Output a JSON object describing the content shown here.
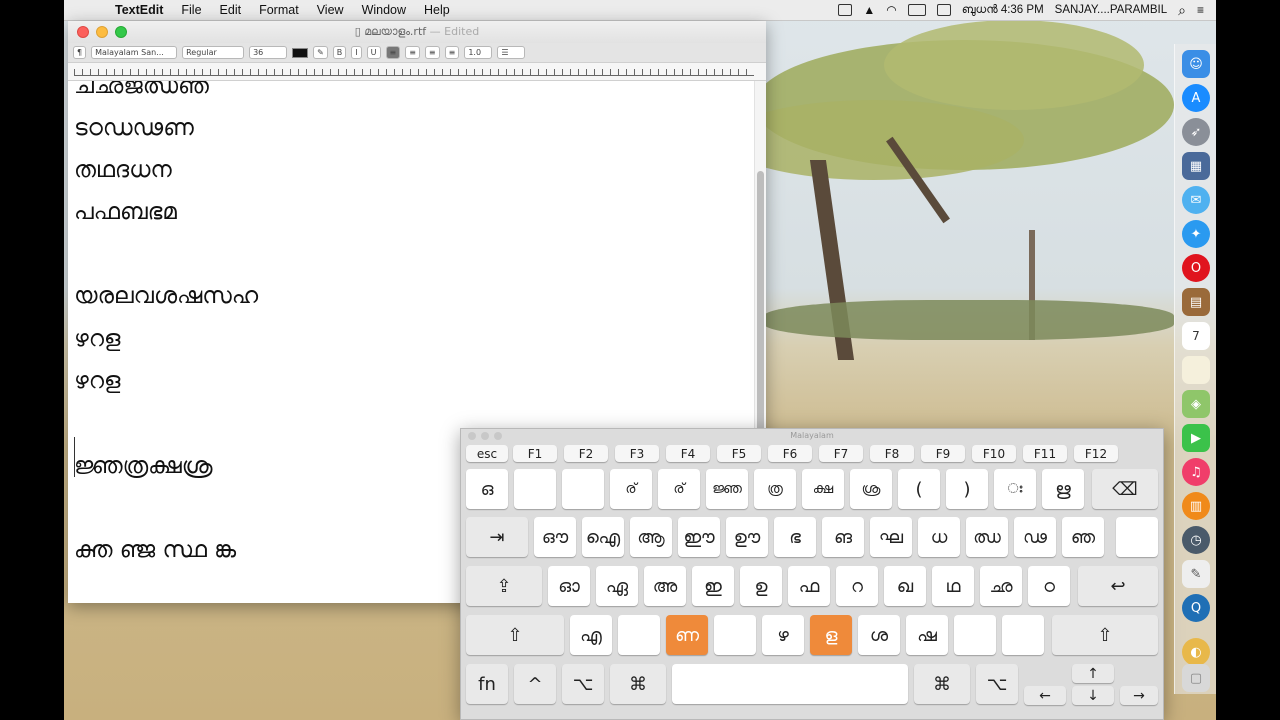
{
  "menubar": {
    "apple_icon": "",
    "app_name": "TextEdit",
    "items": [
      "File",
      "Edit",
      "Format",
      "View",
      "Window",
      "Help"
    ],
    "clock": "ബുധൻ 4:36 PM",
    "user": "SANJAY....PARAMBIL",
    "search_glyph": "⌕",
    "icons": [
      "airplay-icon",
      "upload-icon",
      "wifi-icon",
      "input-source-icon",
      "display-icon",
      "search-icon"
    ]
  },
  "textedit": {
    "filename": "മലയാളം.rtf",
    "edited": "— Edited",
    "toolbar": {
      "paragraph": "¶",
      "font": "Malayalam San...",
      "style": "Regular",
      "size": "36",
      "bold": "B",
      "italic": "I",
      "underline": "U",
      "spacing": "1.0"
    },
    "lines": [
      "ചഛജഝഞ",
      "ടഠഡഢണ",
      "തഥദധന",
      "പഫബഭമ",
      "",
      "യരലവശഷസഹ",
      "ഴറള",
      "ഴറള",
      "",
      "ജ്ഞത്രക്ഷശ്ര",
      "",
      "ക്ത ഞ്ജ സ്ഥ ങ്ക"
    ]
  },
  "keyboard": {
    "title": "Malayalam",
    "fn_row": [
      "esc",
      "F1",
      "F2",
      "F3",
      "F4",
      "F5",
      "F6",
      "F7",
      "F8",
      "F9",
      "F10",
      "F11",
      "F12"
    ],
    "row1": [
      "ഒ",
      "",
      "",
      "ര്",
      "ര്",
      "ജ്ഞ",
      "ത്ര",
      "ക്ഷ",
      "ശ്ര",
      "(",
      ")",
      "ഃ",
      "ഋ",
      "⌫"
    ],
    "row2": [
      "⇥",
      "ഔ",
      "ഐ",
      "ആ",
      "ഈ",
      "ഊ",
      "ഭ",
      "ങ",
      "ഘ",
      "ധ",
      "ഝ",
      "ഢ",
      "ഞ",
      ""
    ],
    "row3": [
      "⇪",
      "ഓ",
      "ഏ",
      "അ",
      "ഇ",
      "ഉ",
      "ഫ",
      "റ",
      "ഖ",
      "ഥ",
      "ഛ",
      "ഠ",
      "↩"
    ],
    "row4": [
      "⇧",
      "എ",
      "",
      "ണ",
      "",
      "ഴ",
      "ള",
      "ശ",
      "ഷ",
      "",
      "",
      "⇧"
    ],
    "row5": [
      "fn",
      "^",
      "⌥",
      "⌘",
      "",
      "⌘",
      "⌥",
      "↑",
      "←",
      "↓",
      "→"
    ],
    "highlight_color": "#ef8a3a"
  },
  "dock": {
    "icons": [
      "finder-icon",
      "app-store-icon",
      "launchpad-icon",
      "mission-control-icon",
      "messages-icon",
      "safari-icon",
      "opera-icon",
      "notes-book-icon",
      "calendar-icon",
      "notes-icon",
      "maps-icon",
      "facetime-icon",
      "itunes-icon",
      "ibooks-icon",
      "time-machine-icon",
      "textedit-icon",
      "quicktime-icon",
      "preview-icon",
      "trash-icon"
    ],
    "calendar_day": "7"
  }
}
